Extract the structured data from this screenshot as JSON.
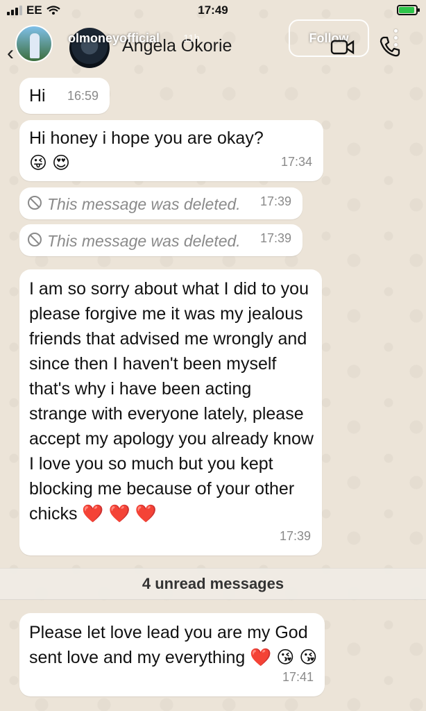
{
  "status_bar": {
    "carrier": "EE",
    "time": "17:49"
  },
  "story_overlay": {
    "username": "olmoneyofficial",
    "age": "11h",
    "follow_label": "Follow"
  },
  "header": {
    "contact_name": "Angela Okorie"
  },
  "messages": [
    {
      "text": "Hi",
      "time": "16:59"
    },
    {
      "text": "Hi honey i hope you are okay?😜 😍",
      "time": "17:34"
    },
    {
      "text": "This message was deleted.",
      "time": "17:39",
      "deleted": true
    },
    {
      "text": "This message was deleted.",
      "time": "17:39",
      "deleted": true
    },
    {
      "text": "I am so sorry about what I did to you please forgive me it was my jealous friends that advised me wrongly and since then I haven't been myself that's why i have been acting strange with everyone lately, please accept my apology you already know I love you so much but you kept blocking me because of your other chicks ❤️ ❤️ ❤️",
      "time": "17:39"
    }
  ],
  "unread_divider": "4 unread messages",
  "after_divider": [
    {
      "text": "Please let love lead you are my God sent love and my everything ❤️ 😘 😘",
      "time": "17:41"
    }
  ],
  "colors": {
    "bubble": "#ffffff",
    "wallpaper": "#ece4d8",
    "timestamp": "#8a8a8a"
  },
  "icons": [
    "back-chevron-icon",
    "video-call-icon",
    "phone-call-icon",
    "more-icon",
    "deleted-ban-icon"
  ]
}
